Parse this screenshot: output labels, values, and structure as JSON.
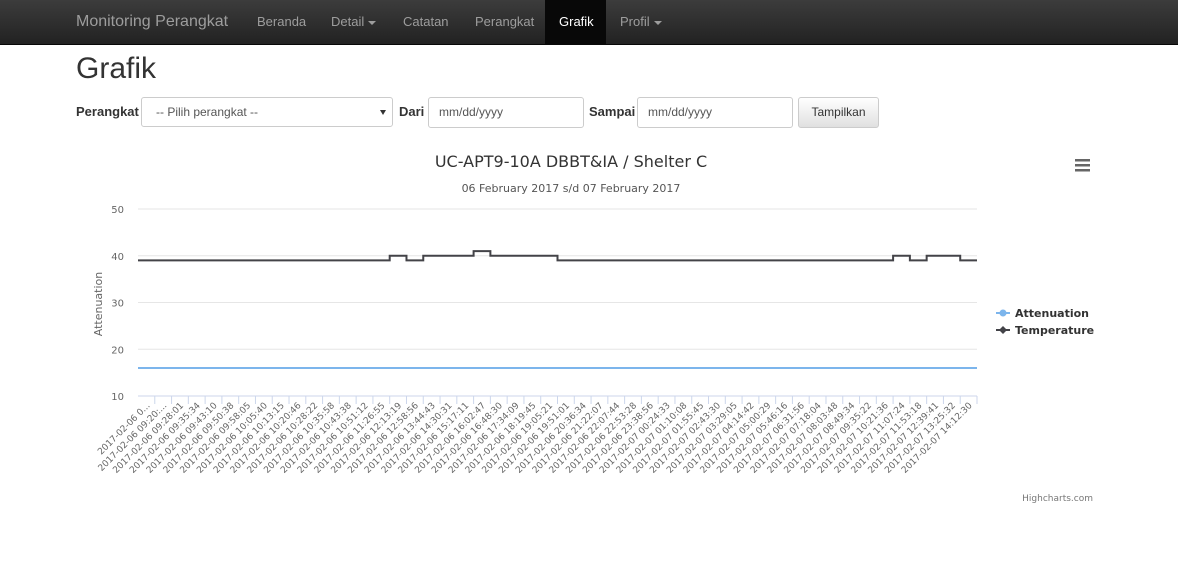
{
  "navbar": {
    "brand": "Monitoring Perangkat",
    "items": [
      {
        "label": "Beranda"
      },
      {
        "label": "Detail"
      },
      {
        "label": "Catatan"
      },
      {
        "label": "Perangkat"
      },
      {
        "label": "Grafik"
      },
      {
        "label": "Profil"
      }
    ]
  },
  "page": {
    "title": "Grafik"
  },
  "filters": {
    "device_label": "Perangkat",
    "device_selected": "-- Pilih perangkat --",
    "from_label": "Dari",
    "from_placeholder": "mm/dd/yyyy",
    "to_label": "Sampai",
    "to_placeholder": "mm/dd/yyyy",
    "submit_label": "Tampilkan"
  },
  "credits": "Highcharts.com",
  "chart_data": {
    "type": "line",
    "title": "UC-APT9-10A DBBT&IA / Shelter C",
    "subtitle": "06 February 2017 s/d 07 February 2017",
    "ylabel": "Attenuation",
    "ylim": [
      10,
      50
    ],
    "yticks": [
      10,
      20,
      30,
      40,
      50
    ],
    "grid": true,
    "legend_position": "right",
    "categories": [
      "2017-02-06 0...",
      "2017-02-06 09:20:...",
      "2017-02-06 09:28:01",
      "2017-02-06 09:35:34",
      "2017-02-06 09:43:10",
      "2017-02-06 09:50:38",
      "2017-02-06 09:58:05",
      "2017-02-06 10:05:40",
      "2017-02-06 10:13:15",
      "2017-02-06 10:20:46",
      "2017-02-06 10:28:22",
      "2017-02-06 10:35:58",
      "2017-02-06 10:43:38",
      "2017-02-06 10:51:12",
      "2017-02-06 11:26:55",
      "2017-02-06 12:13:19",
      "2017-02-06 12:58:56",
      "2017-02-06 13:44:43",
      "2017-02-06 14:30:31",
      "2017-02-06 15:17:11",
      "2017-02-06 16:02:47",
      "2017-02-06 16:48:30",
      "2017-02-06 17:34:09",
      "2017-02-06 18:19:45",
      "2017-02-06 19:05:21",
      "2017-02-06 19:51:01",
      "2017-02-06 20:36:34",
      "2017-02-06 21:22:07",
      "2017-02-06 22:07:44",
      "2017-02-06 22:53:28",
      "2017-02-06 23:38:56",
      "2017-02-07 00:24:33",
      "2017-02-07 01:10:08",
      "2017-02-07 01:55:45",
      "2017-02-07 02:43:30",
      "2017-02-07 03:29:05",
      "2017-02-07 04:14:42",
      "2017-02-07 05:00:29",
      "2017-02-07 05:46:16",
      "2017-02-07 06:31:56",
      "2017-02-07 07:18:04",
      "2017-02-07 08:03:48",
      "2017-02-07 08:49:34",
      "2017-02-07 09:35:22",
      "2017-02-07 10:21:36",
      "2017-02-07 11:07:24",
      "2017-02-07 11:53:18",
      "2017-02-07 12:39:41",
      "2017-02-07 13:25:32",
      "2017-02-07 14:12:30"
    ],
    "series": [
      {
        "name": "Attenuation",
        "color": "#7cb5ec",
        "values": [
          16,
          16,
          16,
          16,
          16,
          16,
          16,
          16,
          16,
          16,
          16,
          16,
          16,
          16,
          16,
          16,
          16,
          16,
          16,
          16,
          16,
          16,
          16,
          16,
          16,
          16,
          16,
          16,
          16,
          16,
          16,
          16,
          16,
          16,
          16,
          16,
          16,
          16,
          16,
          16,
          16,
          16,
          16,
          16,
          16,
          16,
          16,
          16,
          16,
          16
        ]
      },
      {
        "name": "Temperature",
        "color": "#434348",
        "values": [
          39,
          39,
          39,
          39,
          39,
          39,
          39,
          39,
          39,
          39,
          39,
          39,
          39,
          39,
          39,
          40,
          39,
          40,
          40,
          40,
          41,
          40,
          40,
          40,
          40,
          39,
          39,
          39,
          39,
          39,
          39,
          39,
          39,
          39,
          39,
          39,
          39,
          39,
          39,
          39,
          39,
          39,
          39,
          39,
          39,
          40,
          39,
          40,
          40,
          39
        ]
      }
    ]
  }
}
